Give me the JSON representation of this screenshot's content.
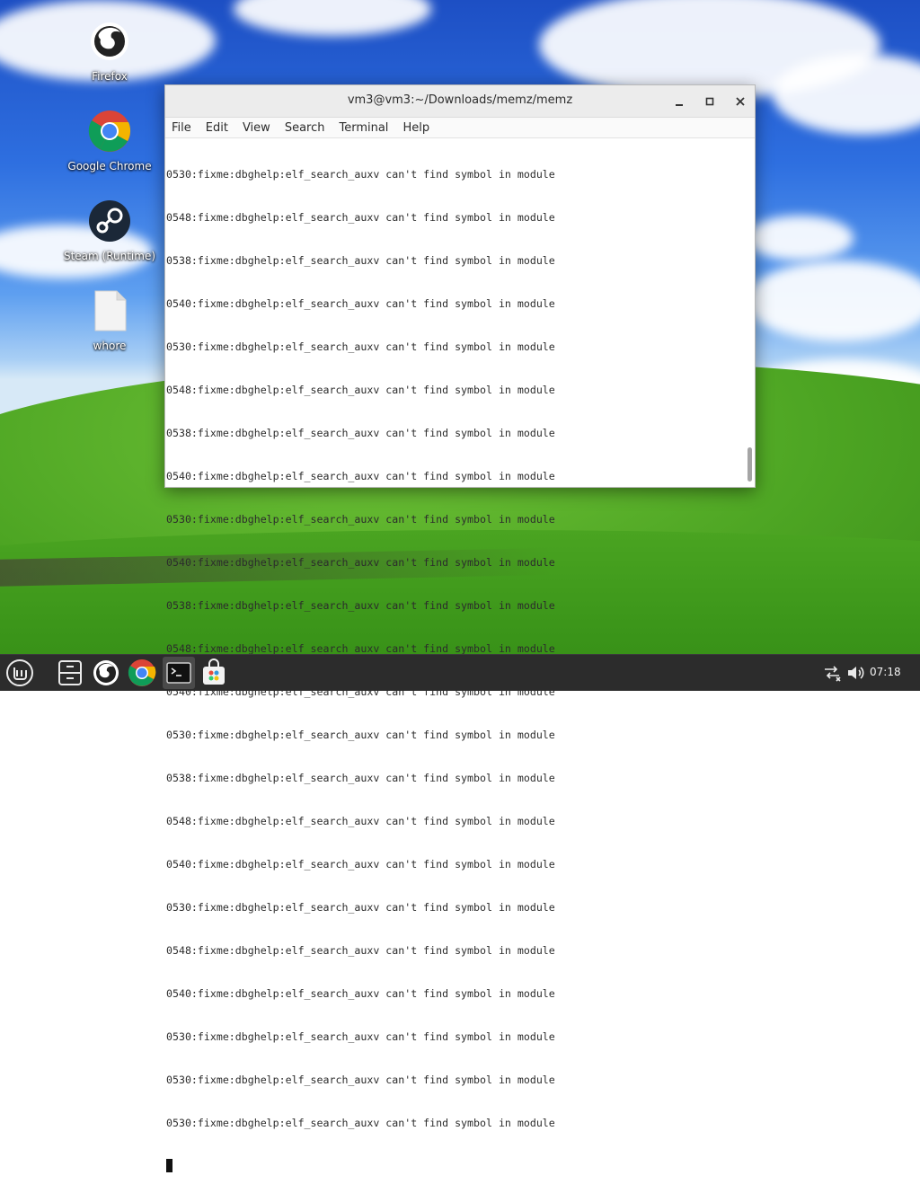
{
  "colors": {
    "terminal_text": "#2c2c2c",
    "taskbar_bg": "#2c2c2c",
    "titlebar_bg": "#ececec",
    "menu_bg": "#fafafa"
  },
  "desktop": {
    "icons": [
      {
        "label": "Firefox",
        "icon": "firefox-icon"
      },
      {
        "label": "Google Chrome",
        "icon": "chrome-icon"
      },
      {
        "label": "Steam (Runtime)",
        "icon": "steam-icon"
      },
      {
        "label": "whore",
        "icon": "file-icon"
      }
    ]
  },
  "terminal": {
    "title": "vm3@vm3:~/Downloads/memz/memz",
    "menu": [
      "File",
      "Edit",
      "View",
      "Search",
      "Terminal",
      "Help"
    ],
    "lines": [
      "0530:fixme:dbghelp:elf_search_auxv can't find symbol in module",
      "0548:fixme:dbghelp:elf_search_auxv can't find symbol in module",
      "0538:fixme:dbghelp:elf_search_auxv can't find symbol in module",
      "0540:fixme:dbghelp:elf_search_auxv can't find symbol in module",
      "0530:fixme:dbghelp:elf_search_auxv can't find symbol in module",
      "0548:fixme:dbghelp:elf_search_auxv can't find symbol in module",
      "0538:fixme:dbghelp:elf_search_auxv can't find symbol in module",
      "0540:fixme:dbghelp:elf_search_auxv can't find symbol in module",
      "0530:fixme:dbghelp:elf_search_auxv can't find symbol in module",
      "0540:fixme:dbghelp:elf_search_auxv can't find symbol in module",
      "0538:fixme:dbghelp:elf_search_auxv can't find symbol in module",
      "0548:fixme:dbghelp:elf_search_auxv can't find symbol in module",
      "0540:fixme:dbghelp:elf_search_auxv can't find symbol in module",
      "0530:fixme:dbghelp:elf_search_auxv can't find symbol in module",
      "0538:fixme:dbghelp:elf_search_auxv can't find symbol in module",
      "0548:fixme:dbghelp:elf_search_auxv can't find symbol in module",
      "0540:fixme:dbghelp:elf_search_auxv can't find symbol in module",
      "0530:fixme:dbghelp:elf_search_auxv can't find symbol in module",
      "0548:fixme:dbghelp:elf_search_auxv can't find symbol in module",
      "0540:fixme:dbghelp:elf_search_auxv can't find symbol in module",
      "0530:fixme:dbghelp:elf_search_auxv can't find symbol in module",
      "0530:fixme:dbghelp:elf_search_auxv can't find symbol in module",
      "0530:fixme:dbghelp:elf_search_auxv can't find symbol in module"
    ]
  },
  "taskbar": {
    "items": [
      "menu-icon",
      "file-manager-icon",
      "firefox-icon",
      "chrome-icon",
      "terminal-icon",
      "software-manager-icon"
    ],
    "tray": [
      "network-icon",
      "volume-icon"
    ],
    "time": "07:18"
  }
}
